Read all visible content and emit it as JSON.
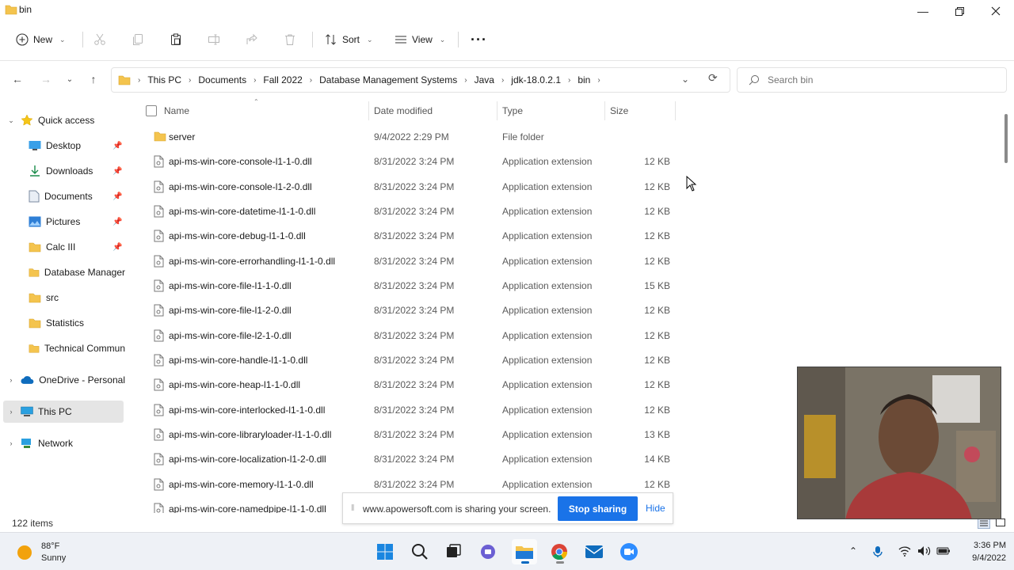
{
  "window": {
    "title": "bin"
  },
  "toolbar": {
    "new_label": "New",
    "sort_label": "Sort",
    "view_label": "View"
  },
  "breadcrumb": [
    "This PC",
    "Documents",
    "Fall 2022",
    "Database Management Systems",
    "Java",
    "jdk-18.0.2.1",
    "bin"
  ],
  "search": {
    "placeholder": "Search bin"
  },
  "sidebar": {
    "quick_access": "Quick access",
    "items": [
      {
        "label": "Desktop",
        "pinned": true
      },
      {
        "label": "Downloads",
        "pinned": true
      },
      {
        "label": "Documents",
        "pinned": true
      },
      {
        "label": "Pictures",
        "pinned": true
      },
      {
        "label": "Calc III",
        "pinned": true
      },
      {
        "label": "Database Manager",
        "pinned": false
      },
      {
        "label": "src",
        "pinned": false
      },
      {
        "label": "Statistics",
        "pinned": false
      },
      {
        "label": "Technical Commun",
        "pinned": false
      }
    ],
    "onedrive": "OneDrive - Personal",
    "this_pc": "This PC",
    "network": "Network"
  },
  "columns": {
    "name": "Name",
    "date": "Date modified",
    "type": "Type",
    "size": "Size"
  },
  "files": [
    {
      "name": "server",
      "date": "9/4/2022 2:29 PM",
      "type": "File folder",
      "size": "",
      "kind": "folder"
    },
    {
      "name": "api-ms-win-core-console-l1-1-0.dll",
      "date": "8/31/2022 3:24 PM",
      "type": "Application extension",
      "size": "12 KB",
      "kind": "dll"
    },
    {
      "name": "api-ms-win-core-console-l1-2-0.dll",
      "date": "8/31/2022 3:24 PM",
      "type": "Application extension",
      "size": "12 KB",
      "kind": "dll"
    },
    {
      "name": "api-ms-win-core-datetime-l1-1-0.dll",
      "date": "8/31/2022 3:24 PM",
      "type": "Application extension",
      "size": "12 KB",
      "kind": "dll"
    },
    {
      "name": "api-ms-win-core-debug-l1-1-0.dll",
      "date": "8/31/2022 3:24 PM",
      "type": "Application extension",
      "size": "12 KB",
      "kind": "dll"
    },
    {
      "name": "api-ms-win-core-errorhandling-l1-1-0.dll",
      "date": "8/31/2022 3:24 PM",
      "type": "Application extension",
      "size": "12 KB",
      "kind": "dll"
    },
    {
      "name": "api-ms-win-core-file-l1-1-0.dll",
      "date": "8/31/2022 3:24 PM",
      "type": "Application extension",
      "size": "15 KB",
      "kind": "dll"
    },
    {
      "name": "api-ms-win-core-file-l1-2-0.dll",
      "date": "8/31/2022 3:24 PM",
      "type": "Application extension",
      "size": "12 KB",
      "kind": "dll"
    },
    {
      "name": "api-ms-win-core-file-l2-1-0.dll",
      "date": "8/31/2022 3:24 PM",
      "type": "Application extension",
      "size": "12 KB",
      "kind": "dll"
    },
    {
      "name": "api-ms-win-core-handle-l1-1-0.dll",
      "date": "8/31/2022 3:24 PM",
      "type": "Application extension",
      "size": "12 KB",
      "kind": "dll"
    },
    {
      "name": "api-ms-win-core-heap-l1-1-0.dll",
      "date": "8/31/2022 3:24 PM",
      "type": "Application extension",
      "size": "12 KB",
      "kind": "dll"
    },
    {
      "name": "api-ms-win-core-interlocked-l1-1-0.dll",
      "date": "8/31/2022 3:24 PM",
      "type": "Application extension",
      "size": "12 KB",
      "kind": "dll"
    },
    {
      "name": "api-ms-win-core-libraryloader-l1-1-0.dll",
      "date": "8/31/2022 3:24 PM",
      "type": "Application extension",
      "size": "13 KB",
      "kind": "dll"
    },
    {
      "name": "api-ms-win-core-localization-l1-2-0.dll",
      "date": "8/31/2022 3:24 PM",
      "type": "Application extension",
      "size": "14 KB",
      "kind": "dll"
    },
    {
      "name": "api-ms-win-core-memory-l1-1-0.dll",
      "date": "8/31/2022 3:24 PM",
      "type": "Application extension",
      "size": "12 KB",
      "kind": "dll"
    },
    {
      "name": "api-ms-win-core-namedpipe-l1-1-0.dll",
      "date": "",
      "type": "",
      "size": "",
      "kind": "dll"
    }
  ],
  "status": {
    "item_count": "122 items"
  },
  "share_banner": {
    "message": "www.apowersoft.com is sharing your screen.",
    "stop_label": "Stop sharing",
    "hide_label": "Hide"
  },
  "taskbar": {
    "temperature": "88°F",
    "condition": "Sunny",
    "time": "3:36 PM",
    "date": "9/4/2022"
  },
  "colors": {
    "accent": "#1a73e8",
    "folder": "#f4c44e",
    "selected_bg": "#e5e5e5"
  }
}
